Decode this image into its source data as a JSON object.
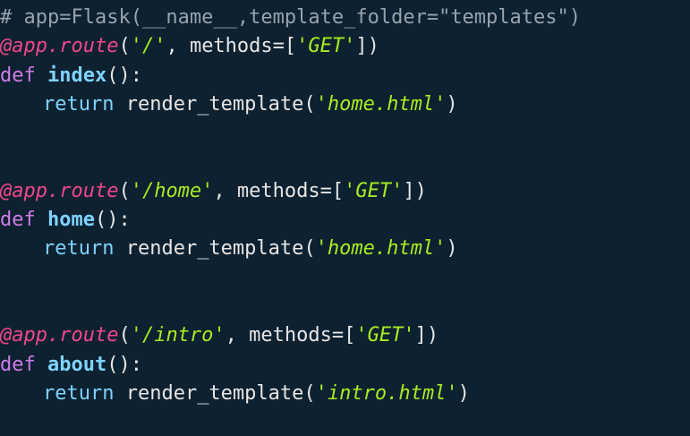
{
  "editor": {
    "colors": {
      "background": "#0d2130",
      "comment": "#97a3ad",
      "decorator": "#f0488b",
      "string": "#a7ec21",
      "keyword": "#cf7bea",
      "function": "#7fd3ff",
      "text": "#e6e6e6"
    },
    "lines": [
      {
        "tokens": [
          {
            "t": "comment",
            "v": "# app=Flask(__name__,template_folder=\"templates\")"
          }
        ]
      },
      {
        "tokens": [
          {
            "t": "decorator",
            "v": "@app.route"
          },
          {
            "t": "punc",
            "v": "("
          },
          {
            "t": "string-i",
            "v": "'/'"
          },
          {
            "t": "punc",
            "v": ", methods=["
          },
          {
            "t": "string-i",
            "v": "'GET'"
          },
          {
            "t": "punc",
            "v": "])"
          }
        ]
      },
      {
        "tokens": [
          {
            "t": "keyword",
            "v": "def "
          },
          {
            "t": "func",
            "v": "index"
          },
          {
            "t": "punc",
            "v": "():"
          }
        ]
      },
      {
        "indent": true,
        "tokens": [
          {
            "t": "return",
            "v": "return "
          },
          {
            "t": "plain",
            "v": "render_template("
          },
          {
            "t": "string-i",
            "v": "'home.html'"
          },
          {
            "t": "punc",
            "v": ")"
          }
        ]
      },
      {
        "tokens": []
      },
      {
        "tokens": []
      },
      {
        "tokens": [
          {
            "t": "decorator",
            "v": "@app.route"
          },
          {
            "t": "punc",
            "v": "("
          },
          {
            "t": "string-i",
            "v": "'/home'"
          },
          {
            "t": "punc",
            "v": ", methods=["
          },
          {
            "t": "string-i",
            "v": "'GET'"
          },
          {
            "t": "punc",
            "v": "])"
          }
        ]
      },
      {
        "tokens": [
          {
            "t": "keyword",
            "v": "def "
          },
          {
            "t": "func",
            "v": "home"
          },
          {
            "t": "punc",
            "v": "():"
          }
        ]
      },
      {
        "indent": true,
        "tokens": [
          {
            "t": "return",
            "v": "return "
          },
          {
            "t": "plain",
            "v": "render_template("
          },
          {
            "t": "string-i",
            "v": "'home.html'"
          },
          {
            "t": "punc",
            "v": ")"
          }
        ]
      },
      {
        "tokens": []
      },
      {
        "tokens": []
      },
      {
        "tokens": [
          {
            "t": "decorator",
            "v": "@app.route"
          },
          {
            "t": "punc",
            "v": "("
          },
          {
            "t": "string-i",
            "v": "'/intro'"
          },
          {
            "t": "punc",
            "v": ", methods=["
          },
          {
            "t": "string-i",
            "v": "'GET'"
          },
          {
            "t": "punc",
            "v": "])"
          }
        ]
      },
      {
        "tokens": [
          {
            "t": "keyword",
            "v": "def "
          },
          {
            "t": "func",
            "v": "about"
          },
          {
            "t": "punc",
            "v": "():"
          }
        ]
      },
      {
        "indent": true,
        "tokens": [
          {
            "t": "return",
            "v": "return "
          },
          {
            "t": "plain",
            "v": "render_template("
          },
          {
            "t": "string-i",
            "v": "'intro.html'"
          },
          {
            "t": "punc",
            "v": ")"
          }
        ]
      }
    ]
  }
}
